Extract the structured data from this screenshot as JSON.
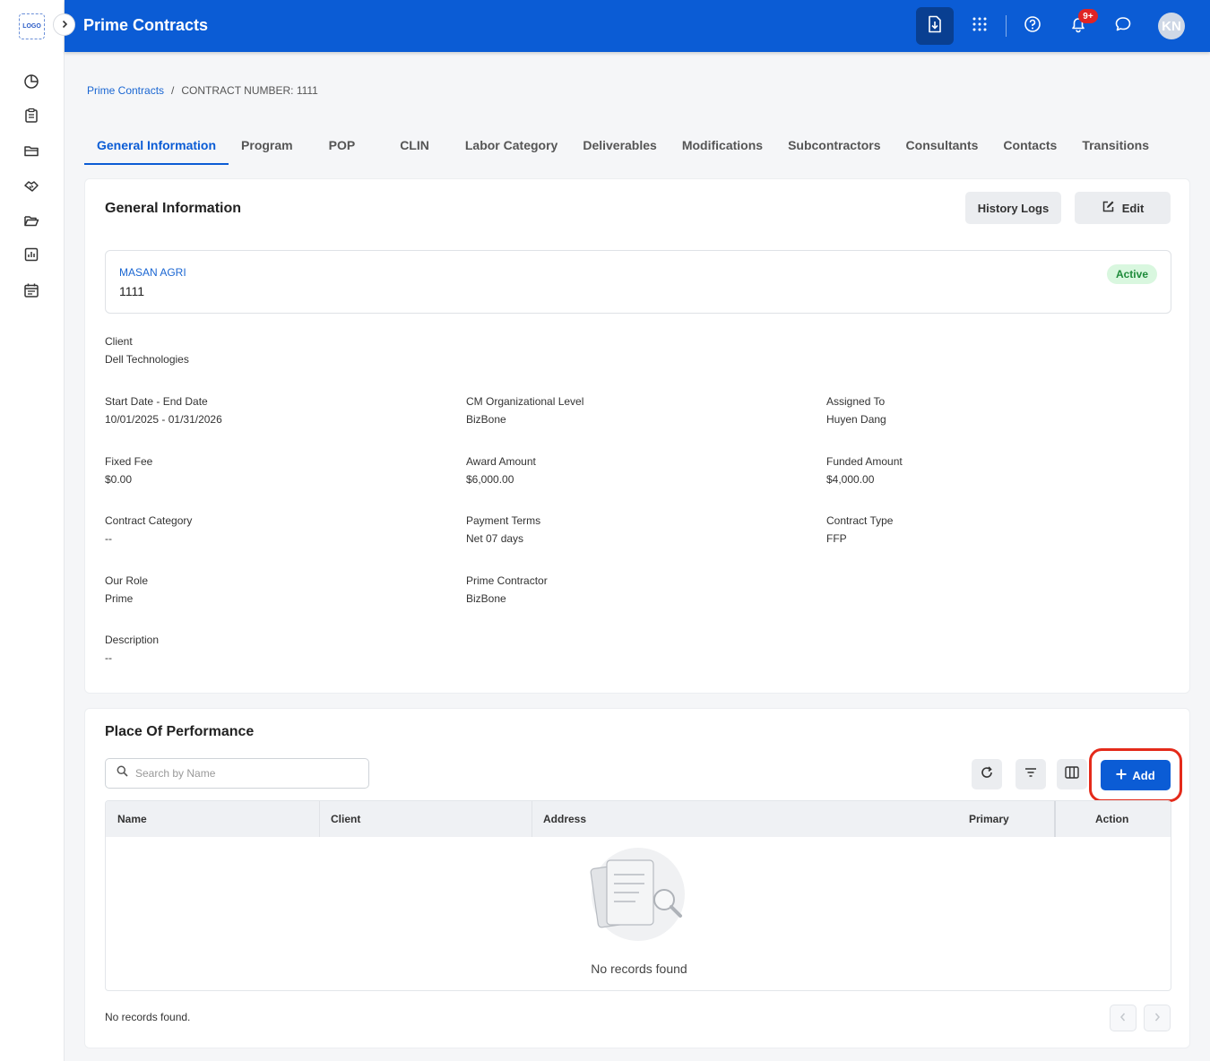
{
  "sidebar": {
    "logo_text": "LOGO",
    "items": [
      {
        "icon": "pie-chart-icon"
      },
      {
        "icon": "clipboard-icon"
      },
      {
        "icon": "folder-icon"
      },
      {
        "icon": "handshake-icon"
      },
      {
        "icon": "folder-open-icon"
      },
      {
        "icon": "bar-chart-icon"
      },
      {
        "icon": "calendar-icon"
      }
    ]
  },
  "header": {
    "title": "Prime Contracts",
    "notification_count": "9+",
    "avatar_initials": "KN",
    "color": "#0b5cd5"
  },
  "breadcrumb": {
    "root": "Prime Contracts",
    "separator": "/",
    "current": "CONTRACT NUMBER: 1111"
  },
  "tabs": [
    {
      "label": "General Information",
      "active": true
    },
    {
      "label": "Program"
    },
    {
      "label": "POP"
    },
    {
      "label": "CLIN"
    },
    {
      "label": "Labor Category"
    },
    {
      "label": "Deliverables"
    },
    {
      "label": "Modifications"
    },
    {
      "label": "Subcontractors"
    },
    {
      "label": "Consultants"
    },
    {
      "label": "Contacts"
    },
    {
      "label": "Transitions"
    }
  ],
  "general": {
    "title": "General Information",
    "history_label": "History Logs",
    "edit_label": "Edit",
    "summary": {
      "name": "MASAN AGRI",
      "number": "1111",
      "status": "Active"
    },
    "fields": {
      "client": {
        "label": "Client",
        "value": "Dell Technologies"
      },
      "dates": {
        "label": "Start Date - End Date",
        "value": "10/01/2025 - 01/31/2026"
      },
      "cm_level": {
        "label": "CM Organizational Level",
        "value": "BizBone"
      },
      "assigned": {
        "label": "Assigned To",
        "value": "Huyen Dang"
      },
      "fixed_fee": {
        "label": "Fixed Fee",
        "value": "$0.00"
      },
      "award": {
        "label": "Award Amount",
        "value": "$6,000.00"
      },
      "funded": {
        "label": "Funded Amount",
        "value": "$4,000.00"
      },
      "category": {
        "label": "Contract Category",
        "value": "--"
      },
      "payment": {
        "label": "Payment Terms",
        "value": "Net 07 days"
      },
      "type": {
        "label": "Contract Type",
        "value": "FFP"
      },
      "role": {
        "label": "Our Role",
        "value": "Prime"
      },
      "prime": {
        "label": "Prime Contractor",
        "value": "BizBone"
      },
      "description": {
        "label": "Description",
        "value": "--"
      }
    }
  },
  "pop": {
    "title": "Place Of Performance",
    "search_placeholder": "Search by Name",
    "add_label": "Add",
    "columns": {
      "name": "Name",
      "client": "Client",
      "address": "Address",
      "primary": "Primary",
      "action": "Action"
    },
    "empty_text": "No records found",
    "footer_text": "No records found."
  }
}
